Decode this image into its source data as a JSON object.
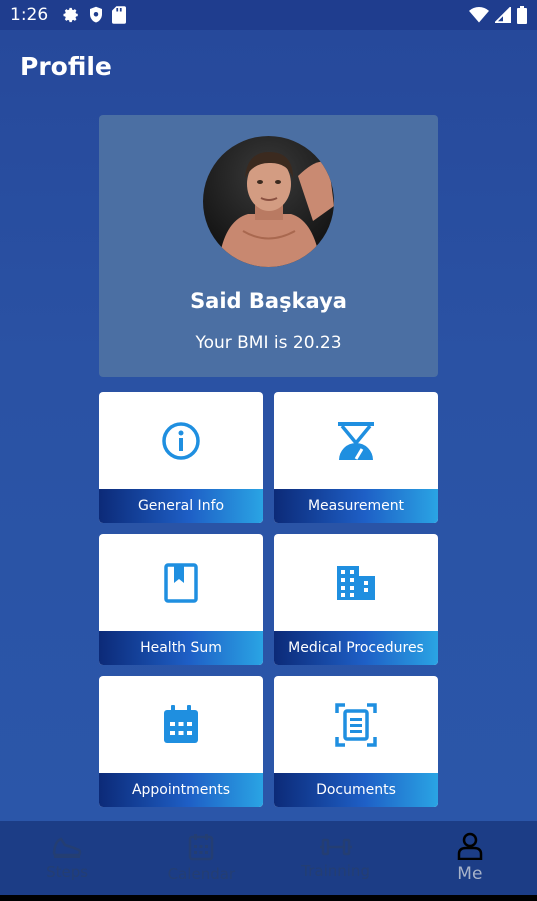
{
  "status_bar": {
    "time": "1:26"
  },
  "page": {
    "title": "Profile"
  },
  "profile": {
    "name": "Said Başkaya",
    "bmi_text": "Your BMI is 20.23"
  },
  "tiles": [
    {
      "label": "General Info",
      "icon": "info-icon"
    },
    {
      "label": "Measurement",
      "icon": "scale-icon"
    },
    {
      "label": "Health Sum",
      "icon": "bookmark-book-icon"
    },
    {
      "label": "Medical Procedures",
      "icon": "building-icon"
    },
    {
      "label": "Appointments",
      "icon": "calendar-icon"
    },
    {
      "label": "Documents",
      "icon": "document-scan-icon"
    }
  ],
  "nav": {
    "items": [
      {
        "label": "Steps",
        "icon": "shoe-icon"
      },
      {
        "label": "Calendar",
        "icon": "calendar-icon"
      },
      {
        "label": "Trainning",
        "icon": "dumbbell-icon"
      },
      {
        "label": "Me",
        "icon": "person-icon"
      }
    ],
    "active": "Me"
  },
  "colors": {
    "background": "#2a52a4",
    "card": "#4b6fa3",
    "tile_icon": "#1f8fe0",
    "nav_bg": "#1c3d86"
  }
}
